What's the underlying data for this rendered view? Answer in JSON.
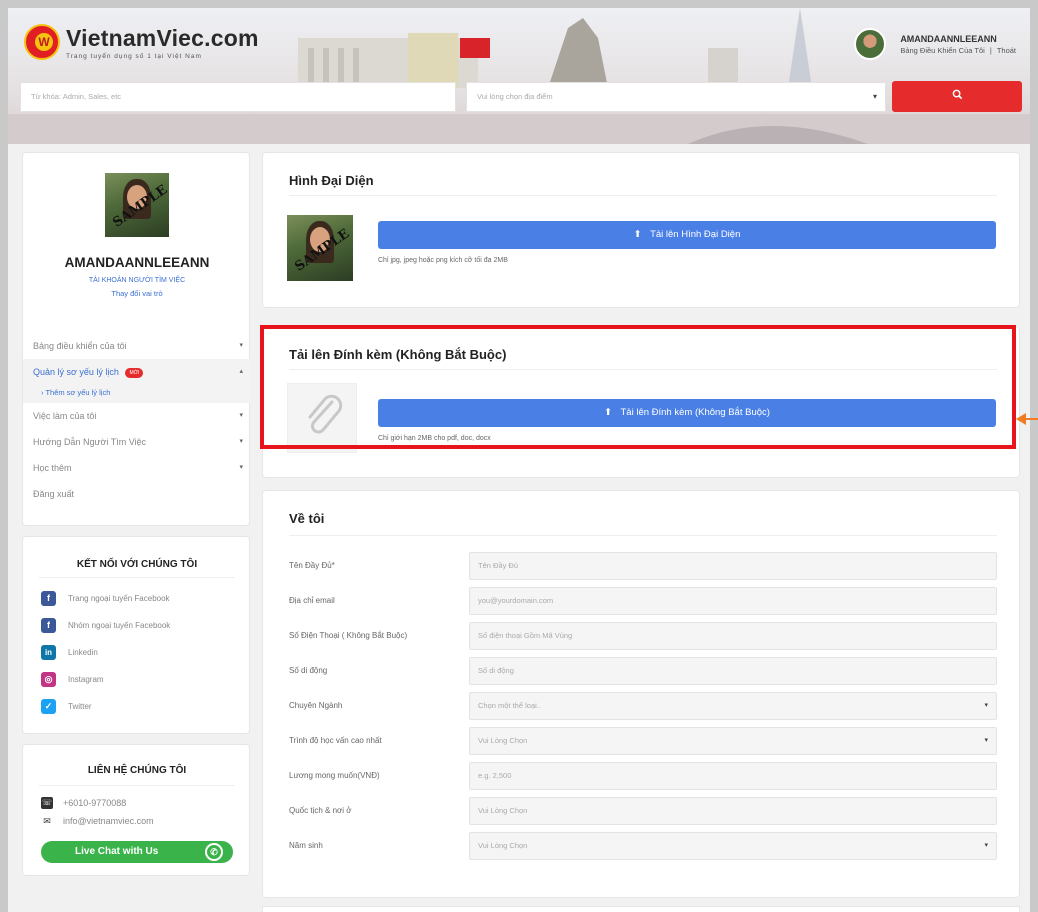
{
  "header": {
    "logo_name": "VietnamViec.com",
    "logo_tagline": "Trang tuyển dụng số 1 tại Việt Nam",
    "logo_mark": "W",
    "user_name": "AMANDAANNLEEANN",
    "dashboard_link": "Bảng Điều Khiển Của Tôi",
    "separator": "|",
    "logout_link": "Thoát",
    "search_placeholder": "Từ khóa: Admin, Sales, etc",
    "location_placeholder": "Vui lòng chọn địa điểm",
    "search_icon": "search-icon"
  },
  "sidebar": {
    "sample_stamp": "SAMPLE",
    "name": "AMANDAANNLEEANN",
    "role": "TÀI KHOẢN NGƯỜI TÌM VIỆC",
    "change_role": "Thay đổi vai trò",
    "menu": [
      {
        "label": "Bảng điều khiển của tôi",
        "chevron": "▾"
      },
      {
        "label": "Quản lý sơ yếu lý lịch",
        "badge": "MỚI",
        "chevron": "▴"
      },
      {
        "label": "› Thêm sơ yếu lý lịch"
      },
      {
        "label": "Việc làm của tôi",
        "chevron": "▾"
      },
      {
        "label": "Hướng Dẫn Người Tìm Việc",
        "chevron": "▾"
      },
      {
        "label": "Học thêm",
        "chevron": "▾"
      },
      {
        "label": "Đăng xuất"
      }
    ],
    "connect_title": "KẾT NỐI VỚI CHÚNG TÔI",
    "social": [
      {
        "label": "Trang ngoại tuyến Facebook",
        "icon": "facebook-icon",
        "glyph": "f",
        "color": "#3b5998"
      },
      {
        "label": "Nhóm ngoại tuyến Facebook",
        "icon": "facebook-icon",
        "glyph": "f",
        "color": "#3b5998"
      },
      {
        "label": "Linkedin",
        "icon": "linkedin-icon",
        "glyph": "in",
        "color": "#0e76a8"
      },
      {
        "label": "Instagram",
        "icon": "instagram-icon",
        "glyph": "◎",
        "color": "#c13584"
      },
      {
        "label": "Twitter",
        "icon": "twitter-icon",
        "glyph": "✓",
        "color": "#1da1f2"
      }
    ],
    "contact_title": "LIÊN HỆ CHÚNG TÔI",
    "phone": "+6010-9770088",
    "email": "info@vietnamviec.com",
    "chat_label": "Live Chat with Us"
  },
  "avatar_section": {
    "title": "Hình Đại Diện",
    "upload_label": "Tải lên Hình Đại Diện",
    "hint": "Chỉ jpg, jpeg hoặc png kích cỡ tối đa 2MB",
    "sample_stamp": "SAMPLE"
  },
  "attachment_section": {
    "title": "Tải lên Đính kèm (Không Bắt Buộc)",
    "upload_label": "Tải lên Đính kèm (Không Bắt Buộc)",
    "hint": "Chỉ giới hạn 2MB cho pdf, doc, docx",
    "placeholder_icon": "paperclip-icon"
  },
  "about_section": {
    "title": "Về tôi",
    "fields": [
      {
        "label": "Tên Đầy Đủ*",
        "placeholder": "Tên Đầy Đủ",
        "type": "input"
      },
      {
        "label": "Địa chỉ email",
        "placeholder": "you@yourdomain.com",
        "type": "input"
      },
      {
        "label": "Số Điện Thoại ( Không Bắt Buộc)",
        "placeholder": "Số điện thoại Gồm Mã Vùng",
        "type": "input"
      },
      {
        "label": "Số di động",
        "placeholder": "Số di động",
        "type": "input"
      },
      {
        "label": "Chuyên Ngành",
        "placeholder": "Chọn một thể loại..",
        "type": "select"
      },
      {
        "label": "Trình độ học vấn cao nhất",
        "placeholder": "Vui Lòng Chọn",
        "type": "select"
      },
      {
        "label": "Lương mong muốn(VNĐ)",
        "placeholder": "e.g. 2,500",
        "type": "input"
      },
      {
        "label": "Quốc tịch & nơi ở",
        "placeholder": "Vui Lòng Chọn",
        "type": "input"
      },
      {
        "label": "Năm sinh",
        "placeholder": "Vui Lòng Chọn",
        "type": "select"
      }
    ]
  },
  "colors": {
    "accent_blue": "#4a80e6",
    "search_red": "#e52b2b",
    "highlight_red": "#e8141b",
    "arrow_orange": "#f07d23",
    "chat_green": "#3ab44a"
  }
}
